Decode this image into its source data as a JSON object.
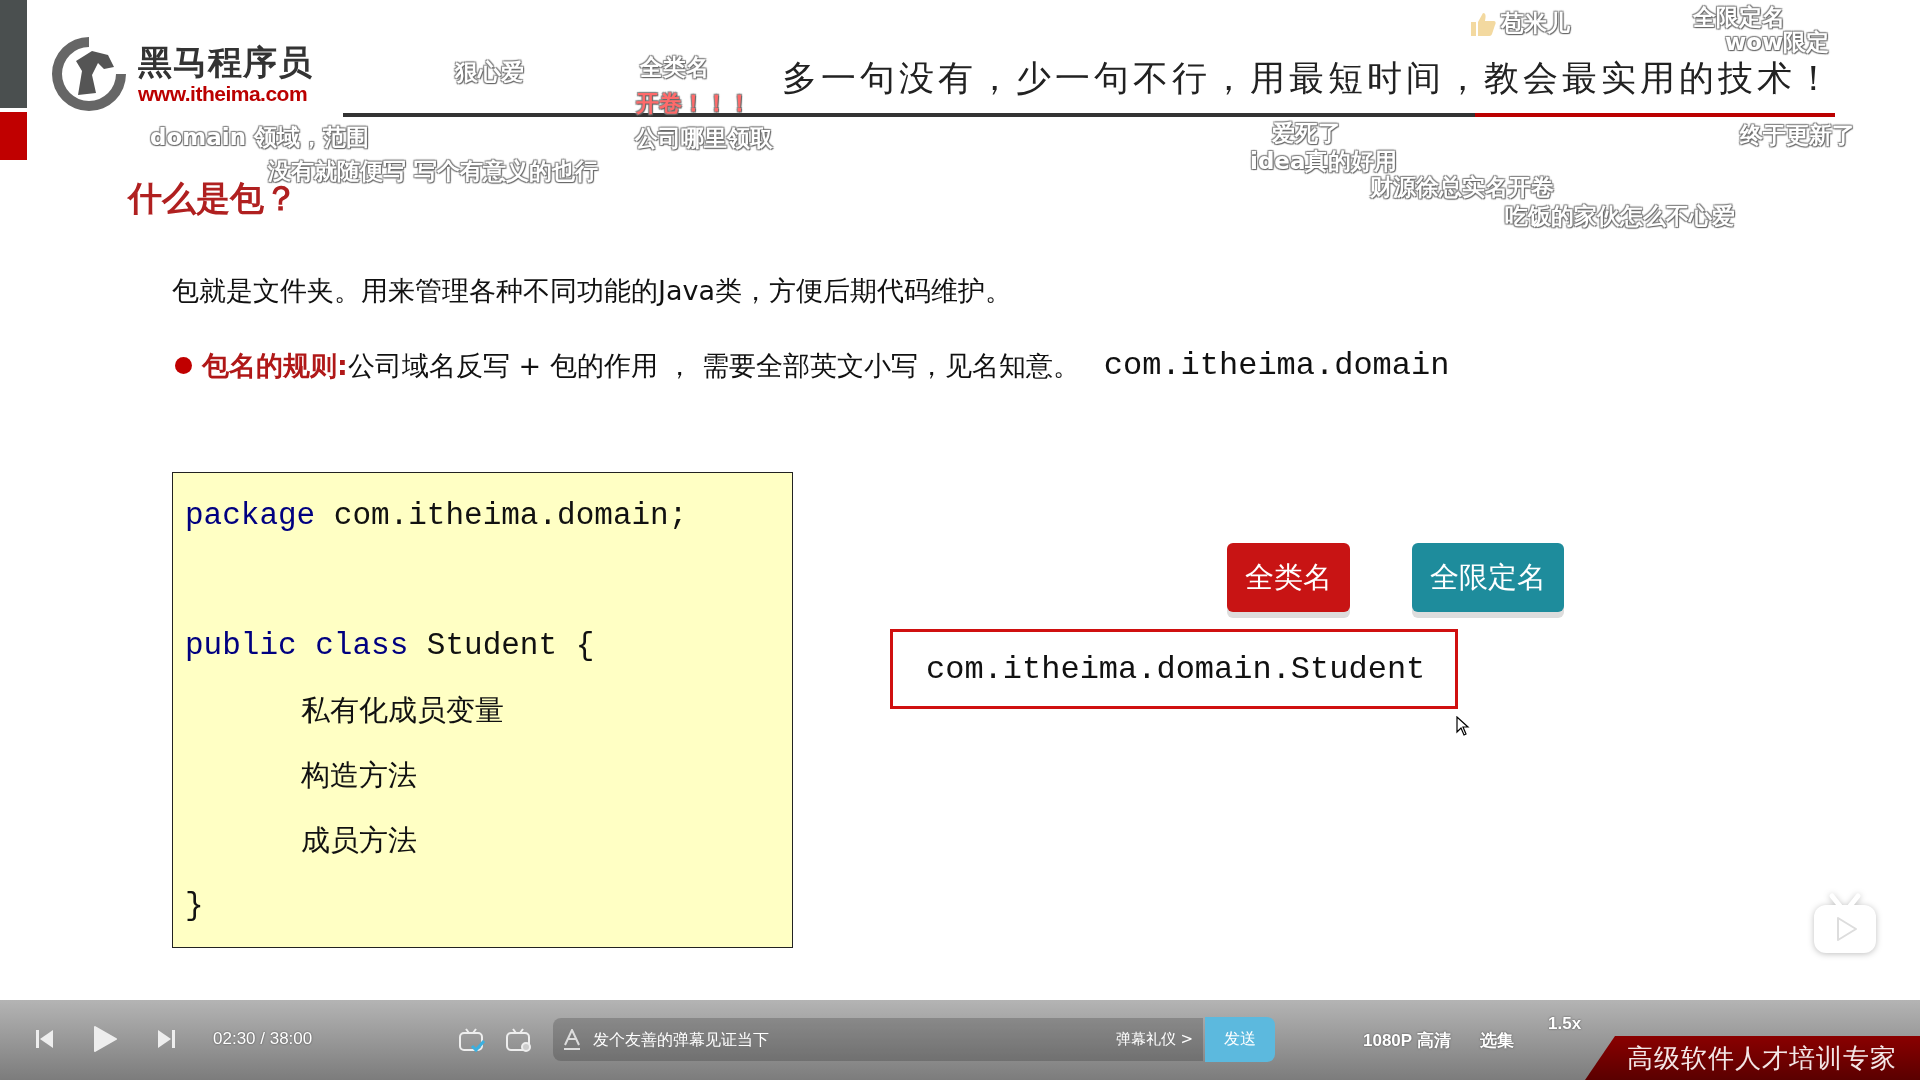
{
  "slide": {
    "logo": {
      "name": "黑马程序员",
      "url": "www.itheima.com"
    },
    "slogan": "多一句没有，少一句不行，用最短时间，教会最实用的技术！",
    "heading": "什么是包？",
    "paragraph": "包就是文件夹。用来管理各种不同功能的Java类，方便后期代码维护。",
    "rule": {
      "label": "包名的规则:",
      "text": "公司域名反写 + 包的作用 ， 需要全部英文小写，见名知意。",
      "example": "com.itheima.domain"
    },
    "code_lines": [
      {
        "kind": "code",
        "tokens": [
          {
            "kind": "keyword",
            "text": "package"
          },
          {
            "kind": "plain",
            "text": " com.itheima.domain;"
          }
        ]
      },
      {
        "kind": "blank"
      },
      {
        "kind": "code",
        "tokens": [
          {
            "kind": "keyword",
            "text": "public class"
          },
          {
            "kind": "plain",
            "text": " Student {"
          }
        ]
      },
      {
        "kind": "indented",
        "tokens": [
          {
            "kind": "plain",
            "text": "私有化成员变量"
          }
        ]
      },
      {
        "kind": "indented",
        "tokens": [
          {
            "kind": "plain",
            "text": "构造方法"
          }
        ]
      },
      {
        "kind": "indented",
        "tokens": [
          {
            "kind": "plain",
            "text": "成员方法"
          }
        ]
      },
      {
        "kind": "code",
        "tokens": [
          {
            "kind": "plain",
            "text": "}"
          }
        ]
      }
    ],
    "buttons": [
      {
        "label": "全类名",
        "color": "#c81414"
      },
      {
        "label": "全限定名",
        "color": "#1e8c9c"
      }
    ],
    "full_name": "com.itheima.domain.Student",
    "banner": "高级软件人才培训专家"
  },
  "danmaku": [
    {
      "text": "domain 领域，范围",
      "color": "#ffffff",
      "liked": false
    },
    {
      "text": "狠心爱",
      "color": "#ffffff",
      "liked": false
    },
    {
      "text": "全类名",
      "color": "#ffffff",
      "liked": false
    },
    {
      "text": "开卷！！！",
      "color": "#ff6a6a",
      "liked": false
    },
    {
      "text": "公司哪里领取",
      "color": "#ffffff",
      "liked": false
    },
    {
      "text": "没有就随便写  写个有意义的也行",
      "color": "#ffffff",
      "liked": false
    },
    {
      "text": "苞米儿",
      "color": "#ffffff",
      "liked": true
    },
    {
      "text": "全限定名",
      "color": "#ffffff",
      "liked": false
    },
    {
      "text": "wow限定",
      "color": "#ffffff",
      "liked": false
    },
    {
      "text": "爱死了",
      "color": "#ffffff",
      "liked": false
    },
    {
      "text": "终于更新了",
      "color": "#ffffff",
      "liked": false
    },
    {
      "text": "idea真的好用",
      "color": "#ffffff",
      "liked": false
    },
    {
      "text": "财源徐总实名开卷",
      "color": "#ffffff",
      "liked": false
    },
    {
      "text": "吃饭的家伙怎么不心爱",
      "color": "#ffffff",
      "liked": false
    }
  ],
  "player": {
    "time": "02:30 / 38:00",
    "danmaku_on": true,
    "placeholder": "发个友善的弹幕见证当下",
    "etiquette": "弹幕礼仪 >",
    "send": "发送",
    "quality": "1080P 高清",
    "episodes": "选集",
    "speed": "1.5x"
  }
}
